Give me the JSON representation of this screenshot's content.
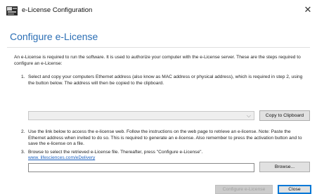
{
  "window": {
    "title": "e-License Configuration",
    "close_glyph": "✕"
  },
  "page": {
    "title": "Configure e-License",
    "intro": "An e-License is required to run the software. It is used to authorize your computer with the e-License server. These are the steps required to configure an e-License:"
  },
  "steps": [
    {
      "number": "1.",
      "text": "Select and copy your computers Ethernet address (also know as MAC address or physical address), which is required in step 2, using the button below. The address will then be copied to the clipboard."
    },
    {
      "number": "2.",
      "text": "Use the link below to access the        e-license web. Follow the instructions on the web page to retrieve an e-license. Note: Paste the Ethernet address when invited to do so. This is required to generate an e-license. Also remember to press the activation button and to save the e-license on a file."
    },
    {
      "number": "3.",
      "text": "Browse to select the retrieved e-License file. Thereafter, press \"Configure e-License\"."
    }
  ],
  "mac_select": {
    "value": "",
    "arrow_glyph": "⌵"
  },
  "buttons": {
    "copy": "Copy to Clipboard",
    "browse": "Browse...",
    "configure": "Configure e-License",
    "close": "Close"
  },
  "link": {
    "text": "www.    lifesciences.com/eDelivery"
  },
  "file_field": {
    "value": "",
    "placeholder": ""
  },
  "colors": {
    "accent": "#2c6fb5",
    "link": "#1a5fbf",
    "default_button_border": "#0078d7"
  },
  "icons": {
    "app": "license-app-icon",
    "close": "close-icon",
    "dropdown": "chevron-down-icon"
  }
}
